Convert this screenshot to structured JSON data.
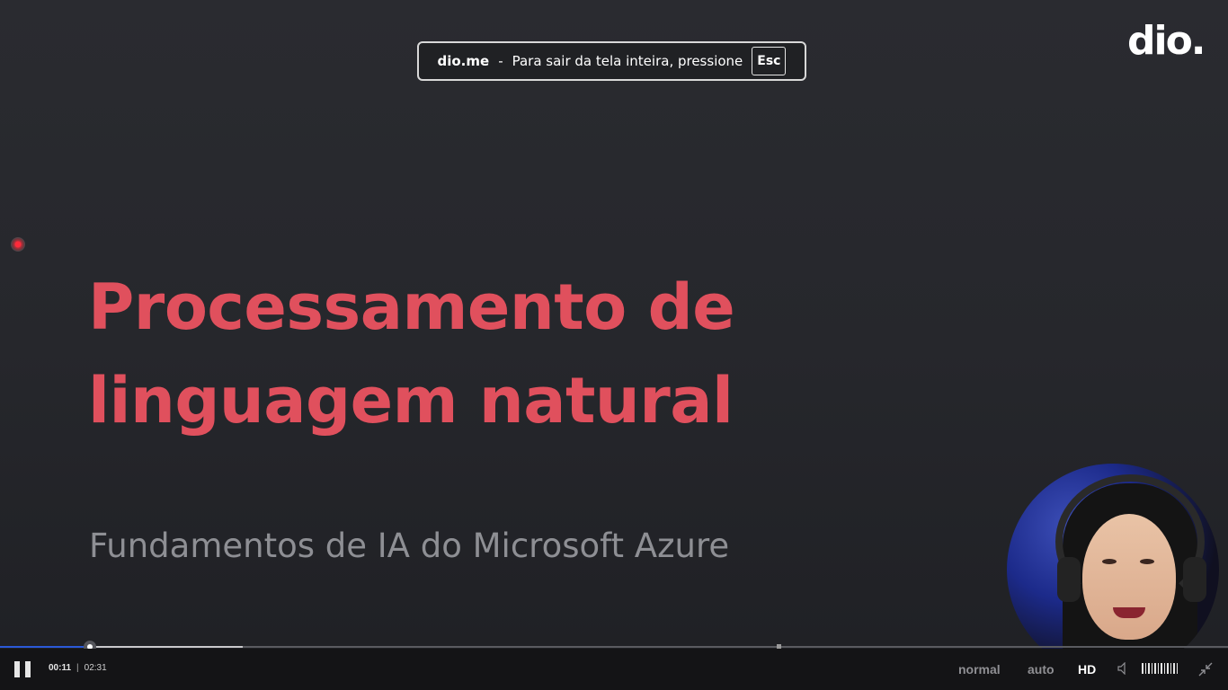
{
  "notice": {
    "site": "dio.me",
    "separator": "-",
    "message": "Para sair da tela inteira, pressione",
    "key": "Esc"
  },
  "logo": {
    "text": "dio."
  },
  "slide": {
    "title_line1": "Processamento de",
    "title_line2": "linguagem natural",
    "subtitle": "Fundamentos de IA do Microsoft Azure"
  },
  "player": {
    "current_time": "00:11",
    "time_separator": "|",
    "duration": "02:31",
    "played_fraction": 0.073,
    "buffered_fraction": 0.198,
    "speed_label": "normal",
    "quality_label": "auto",
    "hd_label": "HD",
    "volume_level_bars": 12,
    "icons": {
      "play_pause": "pause-icon",
      "volume": "speaker-icon",
      "fullscreen": "exit-fullscreen-icon"
    },
    "accent_color": "#2b59d8"
  }
}
